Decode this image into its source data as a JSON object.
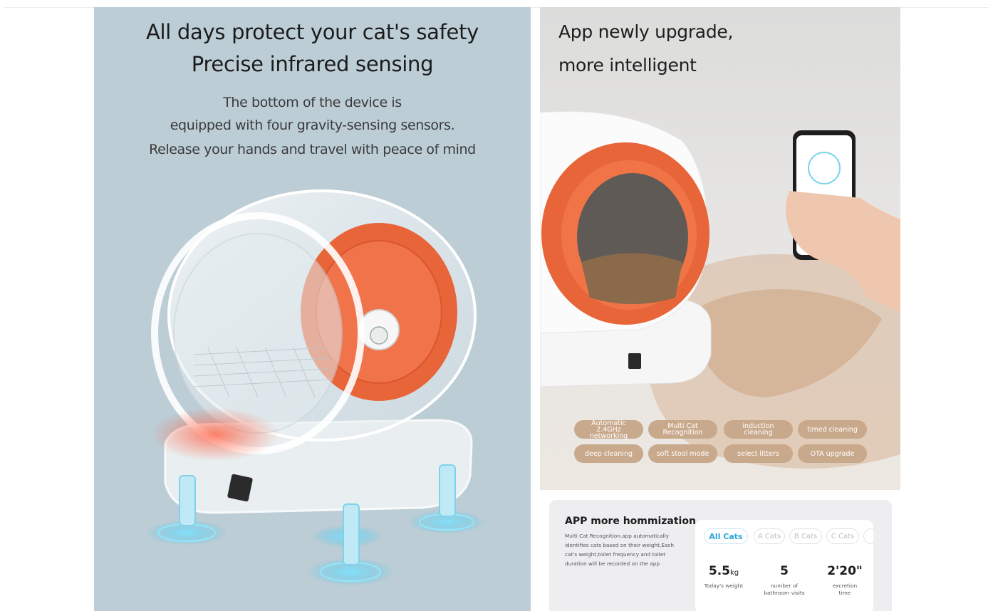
{
  "left_panel": {
    "title_line1": "All days protect your cat's safety",
    "title_line2": "Precise infrared sensing",
    "sub_line1": "The bottom of the device is",
    "sub_line2": "equipped with four gravity-sensing sensors.",
    "sub_line3": "Release your hands and travel with peace of mind"
  },
  "right_panel": {
    "title_line1": "App newly upgrade,",
    "title_line2": "more intelligent",
    "features": [
      "Automatic 2.4GHz networking",
      "Multi Cat Recognition",
      "induction cleaning",
      "timed cleaning",
      "deep cleaning",
      "soft stool mode",
      "select litters",
      "OTA upgrade"
    ]
  },
  "app_card": {
    "title": "APP more hommization",
    "description": "Multi Cat Recognition.app automatically identifies cats based on their weight,Each cat's weight,toilet frequency and toilet duration will be recorded on the app",
    "tabs": [
      "All Cats",
      "A Cats",
      "B Cats",
      "C Cats"
    ],
    "stats": [
      {
        "value": "5.5",
        "unit": "kg",
        "label": "Today's weight"
      },
      {
        "value": "5",
        "unit": "",
        "label": "number of bathroom visits"
      },
      {
        "value": "2'20\"",
        "unit": "",
        "label": "excretion time"
      }
    ]
  },
  "colors": {
    "left_bg": "#bccdd6",
    "accent_orange": "#e8653a",
    "pill_tan": "#c9a98c",
    "tab_blue": "#2aa7d8",
    "sensor_glow": "#3fc2e6"
  }
}
